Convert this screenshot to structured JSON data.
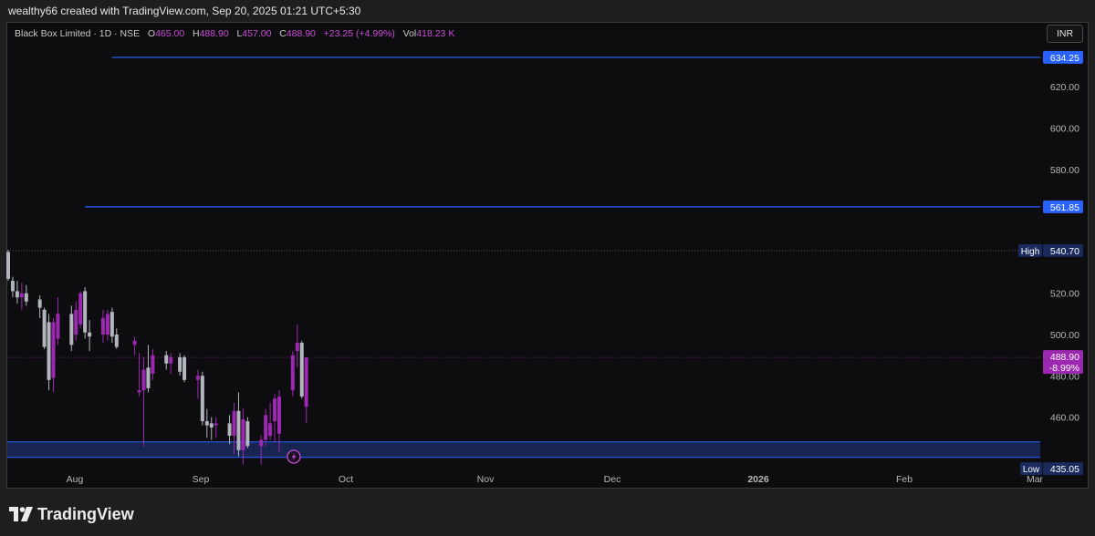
{
  "header": {
    "attribution": "wealthy66 created with TradingView.com, Sep 20, 2025 01:21 UTC+5:30"
  },
  "legend": {
    "symbol": "Black Box Limited · 1D · NSE",
    "o_label": "O",
    "o_value": "465.00",
    "h_label": "H",
    "h_value": "488.90",
    "l_label": "L",
    "l_value": "457.00",
    "c_label": "C",
    "c_value": "488.90",
    "change": "+23.25 (+4.99%)",
    "vol_label": "Vol",
    "vol_value": "418.23 K"
  },
  "currency_button": "INR",
  "footer": {
    "brand": "TradingView"
  },
  "colors": {
    "up": "#9c27b0",
    "down": "#b2b5be",
    "hline": "#2962ff",
    "zone_fill": "#1a2a5c",
    "background": "#0d0d0f"
  },
  "chart_data": {
    "type": "candlestick",
    "y_axis": {
      "ylim": [
        430,
        645
      ],
      "ticks": [
        "620.00",
        "600.00",
        "580.00",
        "500.00",
        "520.00",
        "480.00",
        "460.00"
      ],
      "tick_values": [
        620,
        600,
        580,
        520,
        500,
        480,
        460
      ]
    },
    "x_axis": {
      "labels": [
        "Aug",
        "Sep",
        "Oct",
        "Nov",
        "Dec",
        "2026",
        "Feb",
        "Mar"
      ]
    },
    "horizontal_lines": [
      {
        "price": 634.25,
        "label": "634.25",
        "start_date": "2025-08-13"
      },
      {
        "price": 561.85,
        "label": "561.85",
        "start_date": "2025-08-07"
      }
    ],
    "high_marker": {
      "label": "High",
      "value": "540.70",
      "price": 540.7
    },
    "low_marker": {
      "label": "Low",
      "value": "435.05",
      "price": 435.05
    },
    "last_price": {
      "value": "488.90",
      "change": "-8.99%",
      "price": 488.9
    },
    "support_zone": {
      "top": 448,
      "bottom": 440.5
    },
    "candles": [
      {
        "date": "2025-07-21",
        "o": 540,
        "h": 541,
        "l": 526,
        "c": 527
      },
      {
        "date": "2025-07-22",
        "o": 526,
        "h": 528,
        "l": 518,
        "c": 521
      },
      {
        "date": "2025-07-23",
        "o": 521,
        "h": 526,
        "l": 515,
        "c": 518
      },
      {
        "date": "2025-07-24",
        "o": 518,
        "h": 525,
        "l": 512,
        "c": 520
      },
      {
        "date": "2025-07-25",
        "o": 520,
        "h": 524,
        "l": 514,
        "c": 516
      },
      {
        "date": "2025-07-28",
        "o": 517,
        "h": 519,
        "l": 508,
        "c": 513
      },
      {
        "date": "2025-07-29",
        "o": 512,
        "h": 513,
        "l": 493,
        "c": 494
      },
      {
        "date": "2025-07-30",
        "o": 506,
        "h": 510,
        "l": 473,
        "c": 478
      },
      {
        "date": "2025-07-31",
        "o": 479,
        "h": 508,
        "l": 472,
        "c": 506
      },
      {
        "date": "2025-08-01",
        "o": 498,
        "h": 518,
        "l": 495,
        "c": 510
      },
      {
        "date": "2025-08-04",
        "o": 510,
        "h": 514,
        "l": 492,
        "c": 495
      },
      {
        "date": "2025-08-05",
        "o": 500,
        "h": 516,
        "l": 497,
        "c": 512
      },
      {
        "date": "2025-08-06",
        "o": 505,
        "h": 521,
        "l": 503,
        "c": 520
      },
      {
        "date": "2025-08-07",
        "o": 521,
        "h": 523,
        "l": 498,
        "c": 501
      },
      {
        "date": "2025-08-08",
        "o": 501,
        "h": 507,
        "l": 492,
        "c": 499
      },
      {
        "date": "2025-08-11",
        "o": 500,
        "h": 512,
        "l": 496,
        "c": 508
      },
      {
        "date": "2025-08-12",
        "o": 500,
        "h": 512,
        "l": 497,
        "c": 510
      },
      {
        "date": "2025-08-13",
        "o": 511,
        "h": 513,
        "l": 496,
        "c": 499
      },
      {
        "date": "2025-08-14",
        "o": 500,
        "h": 503,
        "l": 493,
        "c": 494
      },
      {
        "date": "2025-08-18",
        "o": 495,
        "h": 499,
        "l": 490,
        "c": 497
      },
      {
        "date": "2025-08-19",
        "o": 472,
        "h": 491,
        "l": 470,
        "c": 473
      },
      {
        "date": "2025-08-20",
        "o": 473,
        "h": 489,
        "l": 446,
        "c": 483
      },
      {
        "date": "2025-08-21",
        "o": 484,
        "h": 495,
        "l": 472,
        "c": 474
      },
      {
        "date": "2025-08-22",
        "o": 481,
        "h": 493,
        "l": 478,
        "c": 490
      },
      {
        "date": "2025-08-25",
        "o": 490,
        "h": 492,
        "l": 483,
        "c": 486
      },
      {
        "date": "2025-08-26",
        "o": 486,
        "h": 491,
        "l": 481,
        "c": 489
      },
      {
        "date": "2025-08-28",
        "o": 489,
        "h": 491,
        "l": 480,
        "c": 482
      },
      {
        "date": "2025-08-29",
        "o": 489,
        "h": 490,
        "l": 477,
        "c": 478
      },
      {
        "date": "2025-09-01",
        "o": 478,
        "h": 483,
        "l": 469,
        "c": 480
      },
      {
        "date": "2025-09-02",
        "o": 480,
        "h": 482,
        "l": 456,
        "c": 458
      },
      {
        "date": "2025-09-03",
        "o": 458,
        "h": 464,
        "l": 450,
        "c": 456
      },
      {
        "date": "2025-09-04",
        "o": 457,
        "h": 460,
        "l": 449,
        "c": 455
      },
      {
        "date": "2025-09-05",
        "o": 456,
        "h": 460,
        "l": 450,
        "c": 457
      },
      {
        "date": "2025-09-08",
        "o": 457,
        "h": 461,
        "l": 447,
        "c": 451
      },
      {
        "date": "2025-09-09",
        "o": 451,
        "h": 467,
        "l": 442,
        "c": 463
      },
      {
        "date": "2025-09-10",
        "o": 463,
        "h": 472,
        "l": 441,
        "c": 444
      },
      {
        "date": "2025-09-11",
        "o": 444,
        "h": 464,
        "l": 437,
        "c": 459
      },
      {
        "date": "2025-09-12",
        "o": 458,
        "h": 460,
        "l": 445,
        "c": 446
      },
      {
        "date": "2025-09-15",
        "o": 446,
        "h": 451,
        "l": 437,
        "c": 449
      },
      {
        "date": "2025-09-16",
        "o": 449,
        "h": 464,
        "l": 446,
        "c": 461
      },
      {
        "date": "2025-09-17",
        "o": 451,
        "h": 467,
        "l": 449,
        "c": 457
      },
      {
        "date": "2025-09-18",
        "o": 458,
        "h": 471,
        "l": 448,
        "c": 469
      },
      {
        "date": "2025-09-19",
        "o": 452,
        "h": 473,
        "l": 443,
        "c": 470
      },
      {
        "date": "2025-09-22",
        "o": 473,
        "h": 492,
        "l": 470,
        "c": 490
      },
      {
        "date": "2025-09-23",
        "o": 492,
        "h": 505,
        "l": 484,
        "c": 496
      },
      {
        "date": "2025-09-24",
        "o": 496,
        "h": 497,
        "l": 469,
        "c": 470
      },
      {
        "date": "2025-09-25",
        "o": 465,
        "h": 489,
        "l": 457,
        "c": 488.9
      }
    ]
  }
}
